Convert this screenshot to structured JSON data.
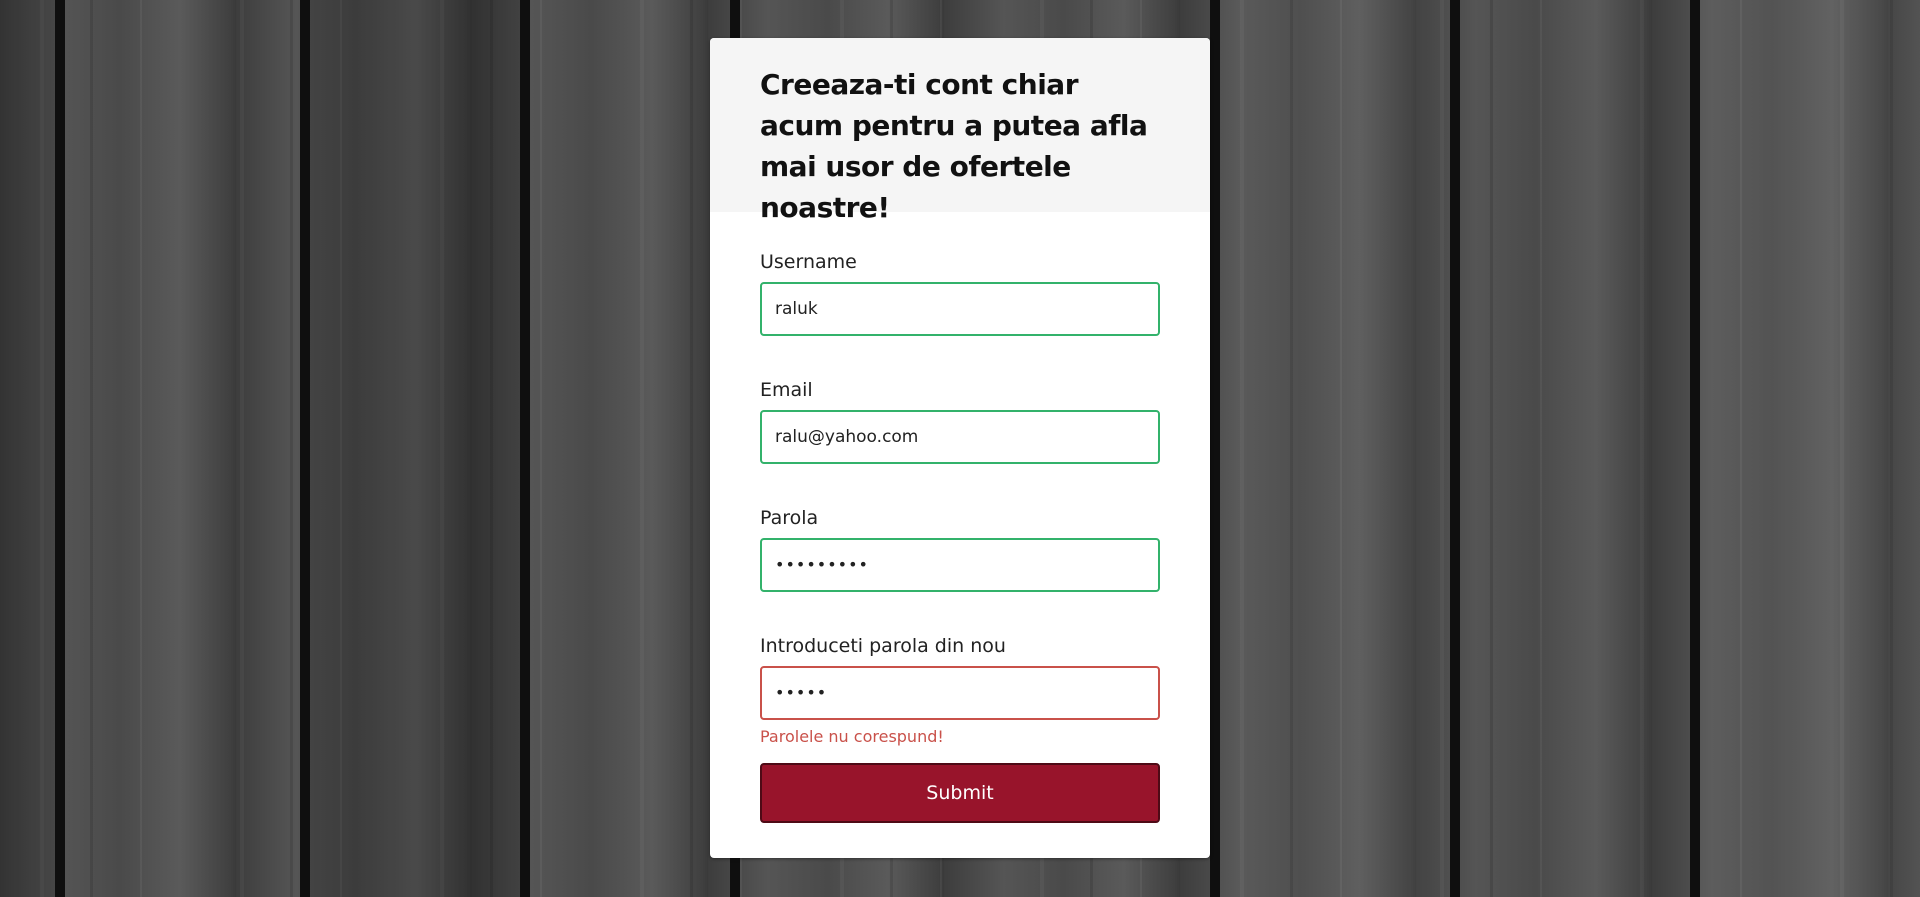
{
  "header": {
    "title": "Creeaza-ti cont chiar acum pentru a putea afla mai usor de ofertele noastre!"
  },
  "form": {
    "username": {
      "label": "Username",
      "value": "raluk"
    },
    "email": {
      "label": "Email",
      "value": "ralu@yahoo.com"
    },
    "password": {
      "label": "Parola",
      "value": "•••••••••"
    },
    "confirm_password": {
      "label": "Introduceti parola din nou",
      "value": "•••••",
      "error": "Parolele nu corespund!"
    },
    "submit_label": "Submit"
  },
  "colors": {
    "valid_border": "#33b26b",
    "error_border": "#c9514a",
    "button_bg": "#98142b"
  }
}
